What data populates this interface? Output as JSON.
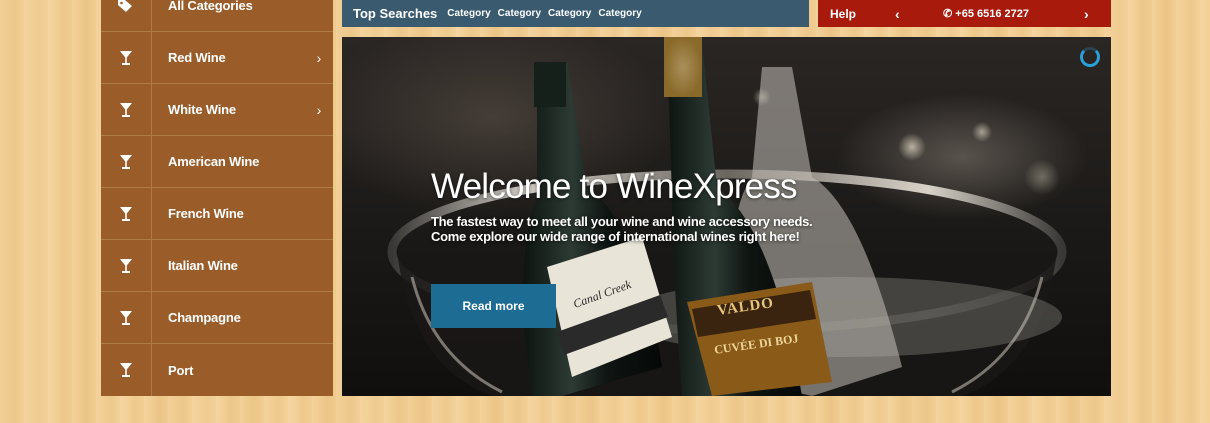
{
  "sidebar": {
    "items": [
      {
        "label": "All Categories",
        "icon": "tags-icon",
        "chevron": ""
      },
      {
        "label": "Red Wine",
        "icon": "wine-glass-icon",
        "chevron": "›"
      },
      {
        "label": "White Wine",
        "icon": "wine-glass-icon",
        "chevron": "›"
      },
      {
        "label": "American Wine",
        "icon": "wine-glass-icon",
        "chevron": ""
      },
      {
        "label": "French Wine",
        "icon": "wine-glass-icon",
        "chevron": ""
      },
      {
        "label": "Italian Wine",
        "icon": "wine-glass-icon",
        "chevron": ""
      },
      {
        "label": "Champagne",
        "icon": "wine-glass-icon",
        "chevron": ""
      },
      {
        "label": "Port",
        "icon": "wine-glass-icon",
        "chevron": ""
      }
    ]
  },
  "search": {
    "title": "Top Searches",
    "categories": [
      "Category",
      "Category",
      "Category",
      "Category"
    ]
  },
  "help": {
    "label": "Help",
    "prev": "‹",
    "phone": "+65 6516 2727",
    "next": "›"
  },
  "hero": {
    "title": "Welcome to WineXpress",
    "line1": "The fastest way to meet all your wine and wine accessory needs.",
    "line2": "Come explore our wide range of international wines right here!",
    "button": "Read more",
    "label_creek": "Canal Creek",
    "label_valdo": "VALDO",
    "label_cuvee": "CUVÉE DI BOJ"
  },
  "colors": {
    "sidebar": "#9a5d2a",
    "search_bar": "#3a5a70",
    "help_bar": "#a81a0b",
    "button": "#1c6c93",
    "spinner": "#2a9fd8"
  }
}
